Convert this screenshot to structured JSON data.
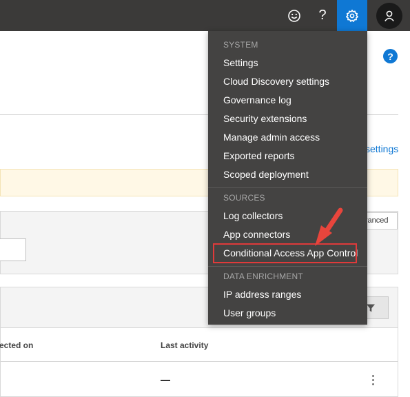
{
  "topbar": {
    "icons": [
      "smiley-icon",
      "help-icon",
      "gear-icon",
      "user-icon"
    ],
    "help_glyph": "?"
  },
  "background": {
    "help_glyph": "?",
    "settings_link": "settings",
    "advanced_label": "vanced",
    "columns": [
      "ected on",
      "Last activity"
    ]
  },
  "menu": {
    "sections": [
      {
        "header": "SYSTEM",
        "items": [
          "Settings",
          "Cloud Discovery settings",
          "Governance log",
          "Security extensions",
          "Manage admin access",
          "Exported reports",
          "Scoped deployment"
        ]
      },
      {
        "header": "SOURCES",
        "items": [
          "Log collectors",
          "App connectors",
          "Conditional Access App Control"
        ]
      },
      {
        "header": "DATA ENRICHMENT",
        "items": [
          "IP address ranges",
          "User groups"
        ]
      }
    ]
  },
  "colors": {
    "topbar": "#3b3a39",
    "accent": "#0f78d4",
    "menu_bg": "#444342",
    "highlight": "#e03a3a"
  }
}
